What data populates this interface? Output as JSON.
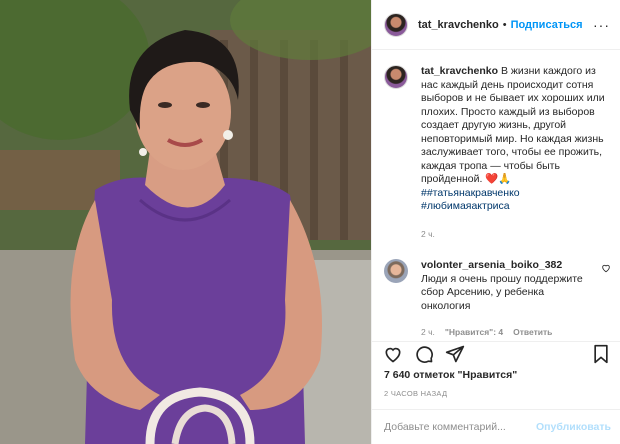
{
  "post": {
    "username": "tat_kravchenko",
    "follow_label": "Подписаться",
    "dot": "•",
    "more_label": "···"
  },
  "caption": {
    "username": "tat_kravchenko",
    "text": "В жизни каждого из нас каждый день происходит сотня выборов и не бывает их хороших или плохих. Просто каждый из выборов создает другую жизнь, другой неповторимый мир. Но каждая жизнь заслуживает того, чтобы ее прожить, каждая тропа — чтобы быть пройденной. ❤️🙏",
    "hashtags": [
      "##татьянакравченко",
      "#любимаяактриса"
    ],
    "time": "2 ч."
  },
  "comment": {
    "username": "volonter_arsenia_boiko_382",
    "text": "Люди я очень прошу поддержите сбор Арсению, у ребенка онкология",
    "time": "2 ч.",
    "likes": "\"Нравится\": 4",
    "reply": "Ответить"
  },
  "likes": "7 640 отметок \"Нравится\"",
  "time_ago": "2 ЧАСОВ НАЗАД",
  "add_comment": {
    "placeholder": "Добавьте комментарий...",
    "publish_label": "Опубликовать"
  },
  "icons": [
    "heart-icon",
    "comment-icon",
    "share-icon",
    "bookmark-icon",
    "more-icon"
  ],
  "colors": {
    "link": "#0095f6",
    "hashtag": "#00376b",
    "muted": "#8e8e8e",
    "dress": "#6b3f9a"
  }
}
